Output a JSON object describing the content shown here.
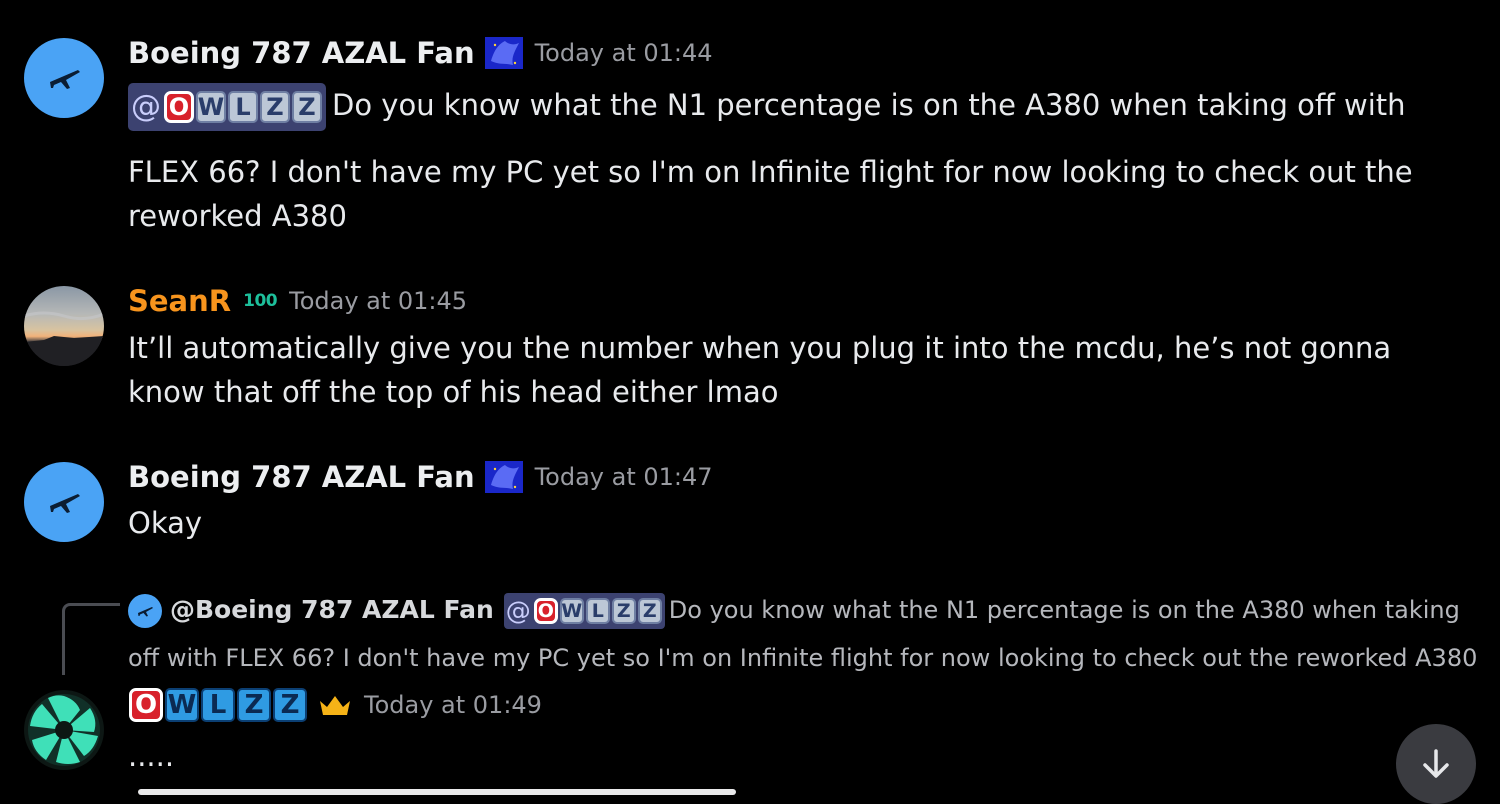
{
  "messages": [
    {
      "username": "Boeing 787 AZAL Fan",
      "timestamp": "Today at 01:44",
      "mention_at": "@",
      "mention_name": [
        "O",
        "W",
        "L",
        "Z",
        "Z"
      ],
      "text_first": "Do you know what the N1 percentage is on the A380 when taking off with",
      "text_rest": "FLEX 66? I don't have my PC yet so I'm on Infinite flight for now looking to check out the reworked A380",
      "avatar_icon": "airplane-icon",
      "badge_icon": "blue-flag-icon"
    },
    {
      "username": "SeanR",
      "badge": "100",
      "timestamp": "Today at 01:45",
      "text": "It’ll automatically give you the number when you plug it into the mcdu, he’s not gonna know that off the top of his head either lmao",
      "name_color": "#f7941d"
    },
    {
      "username": "Boeing 787 AZAL Fan",
      "timestamp": "Today at 01:47",
      "text": "Okay",
      "avatar_icon": "airplane-icon",
      "badge_icon": "blue-flag-icon"
    }
  ],
  "reply": {
    "reply_to_user": "@Boeing 787 AZAL Fan",
    "mention_at": "@",
    "mention_name": [
      "O",
      "W",
      "L",
      "Z",
      "Z"
    ],
    "preview_text": "Do you know what the N1 percentage is on the A380 when taking off with FLEX 66? I don't have my PC yet so I'm on Infinite flight for now looking to check out the reworked A380",
    "author_keys": [
      "O",
      "W",
      "L",
      "Z",
      "Z"
    ],
    "author_icon": "crown-icon",
    "timestamp": "Today at 01:49",
    "text": "....."
  },
  "scroll_button_icon": "arrow-down-icon",
  "colors": {
    "background": "#000000",
    "mention_bg": "#3c4270",
    "orange_name": "#f7941d",
    "avatar_blue": "#4aa3f5"
  }
}
